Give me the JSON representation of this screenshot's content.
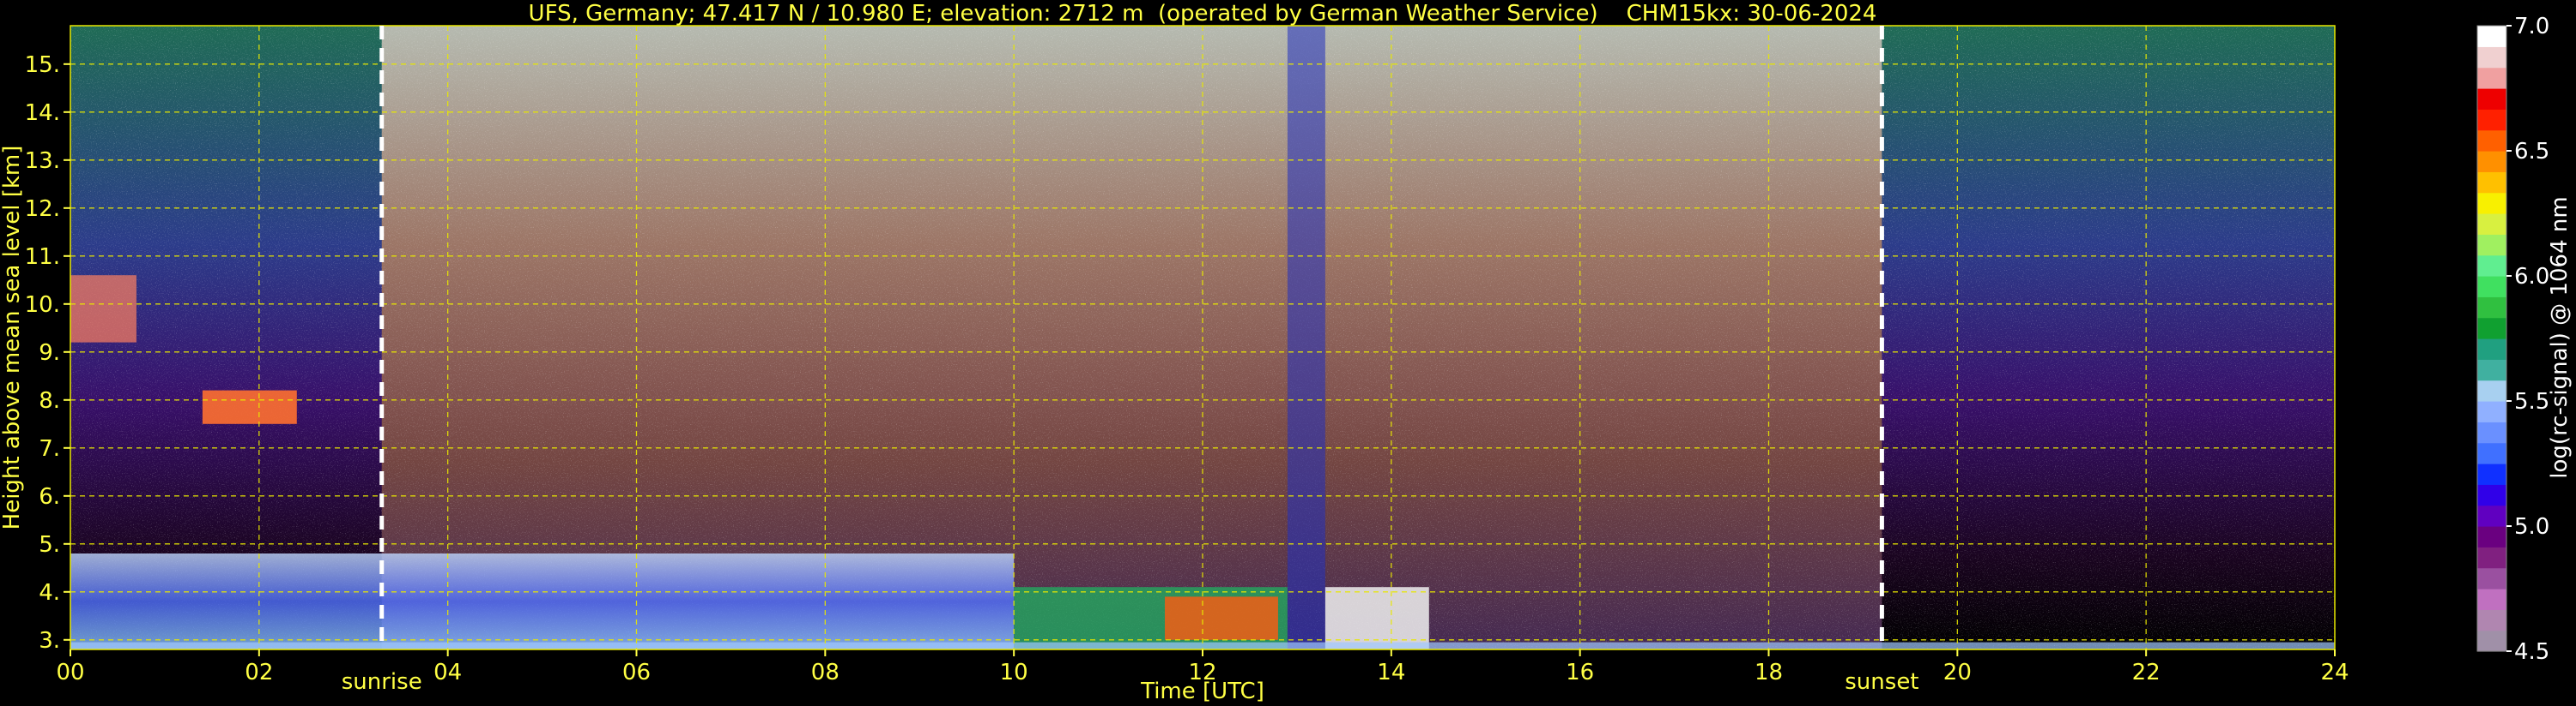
{
  "chart_data": {
    "type": "heatmap",
    "title": "UFS, Germany; 47.417 N / 10.980 E; elevation: 2712 m  (operated by German Weather Service)    CHM15kx: 30-06-2024",
    "xlabel": "Time [UTC]",
    "ylabel": "Height above mean sea level [km]",
    "xlim": [
      0,
      24
    ],
    "ylim": [
      2.8,
      15.8
    ],
    "x_ticks": [
      "00",
      "02",
      "04",
      "06",
      "08",
      "10",
      "12",
      "14",
      "16",
      "18",
      "20",
      "22",
      "24"
    ],
    "y_ticks": [
      "3.",
      "4.",
      "5.",
      "6.",
      "7.",
      "8.",
      "9.",
      "10.",
      "11.",
      "12.",
      "13.",
      "14.",
      "15."
    ],
    "grid": true,
    "annotations": [
      {
        "label": "sunrise",
        "x": 3.3
      },
      {
        "label": "sunset",
        "x": 19.2
      }
    ],
    "colorbar": {
      "label": "log(rc-signal) @ 1064 nm",
      "range": [
        4.5,
        7.0
      ],
      "ticks": [
        "4.5",
        "5.0",
        "5.5",
        "6.0",
        "6.5",
        "7.0"
      ],
      "colors": [
        "#a090a8",
        "#b086b0",
        "#c070c0",
        "#9a50a0",
        "#802080",
        "#6a0080",
        "#6000c0",
        "#3000e8",
        "#1030ff",
        "#4070ff",
        "#6a90ff",
        "#90b0ff",
        "#a8d0f0",
        "#40b0a0",
        "#20a080",
        "#10a030",
        "#30c040",
        "#40e060",
        "#60ee90",
        "#a0f060",
        "#d8f040",
        "#f8f000",
        "#ffc000",
        "#ff9000",
        "#ff6000",
        "#ff2000",
        "#ee0000",
        "#f0a0a0",
        "#f0d0d0",
        "#ffffff"
      ]
    }
  }
}
